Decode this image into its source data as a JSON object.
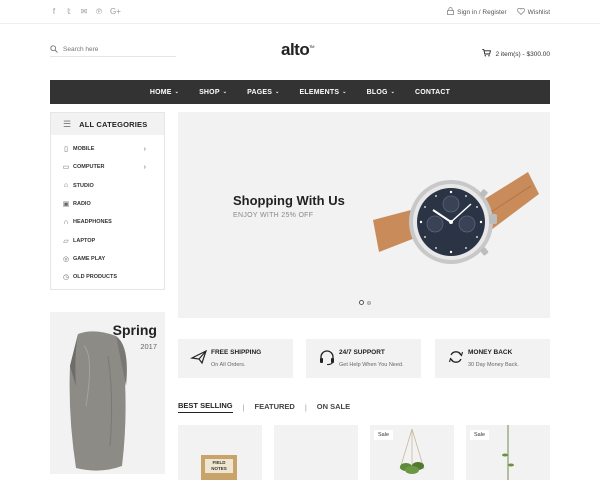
{
  "topbar": {
    "social_icons": [
      "facebook-icon",
      "twitter-icon",
      "mail-icon",
      "pinterest-icon",
      "google-plus-icon"
    ],
    "social_glyphs": [
      "f",
      "𝕥",
      "✉",
      "℗",
      "G+"
    ],
    "signin_label": "Sign in / Register",
    "wishlist_label": "Wishlist"
  },
  "header": {
    "search_placeholder": "Search here",
    "logo": "alto",
    "logo_tm": "TM",
    "cart_text": "2 item(s) - $300.00"
  },
  "nav": {
    "items": [
      "HOME",
      "SHOP",
      "PAGES",
      "ELEMENTS",
      "BLOG",
      "CONTACT"
    ]
  },
  "categories": {
    "title": "ALL CATEGORIES",
    "items": [
      {
        "label": "MOBILE",
        "icon": "mobile-icon",
        "has_arrow": true
      },
      {
        "label": "COMPUTER",
        "icon": "computer-icon",
        "has_arrow": true
      },
      {
        "label": "STUDIO",
        "icon": "studio-icon",
        "has_arrow": false
      },
      {
        "label": "RADIO",
        "icon": "radio-icon",
        "has_arrow": false
      },
      {
        "label": "HEADPHONES",
        "icon": "headphones-icon",
        "has_arrow": false
      },
      {
        "label": "LAPTOP",
        "icon": "laptop-icon",
        "has_arrow": false
      },
      {
        "label": "GAME PLAY",
        "icon": "gamepad-icon",
        "has_arrow": false
      },
      {
        "label": "OLD PRODUCTS",
        "icon": "clock-icon",
        "has_arrow": false
      }
    ]
  },
  "hero": {
    "title": "Shopping With Us",
    "subtitle": "ENJOY WITH 25% OFF"
  },
  "promo": {
    "title": "Spring",
    "year": "2017"
  },
  "services": [
    {
      "title": "FREE SHIPPING",
      "desc": "On All Orders.",
      "icon": "airplane-icon"
    },
    {
      "title": "24/7 SUPPORT",
      "desc": "Get Help When You Need.",
      "icon": "headset-icon"
    },
    {
      "title": "MONEY BACK",
      "desc": "30 Day Money Back.",
      "icon": "refresh-icon"
    }
  ],
  "tabs": {
    "items": [
      "BEST SELLING",
      "FEATURED",
      "ON SALE"
    ],
    "active": "BEST SELLING",
    "separator": "|"
  },
  "products": {
    "sale_badge": "Sale",
    "notebook_text": "FIELD NOTES"
  },
  "colors": {
    "nav_bg": "#333333",
    "panel_bg": "#f2f2f2",
    "watch_strap": "#c98b5a",
    "watch_dial": "#2b3444",
    "bag": "#8d8b86"
  }
}
